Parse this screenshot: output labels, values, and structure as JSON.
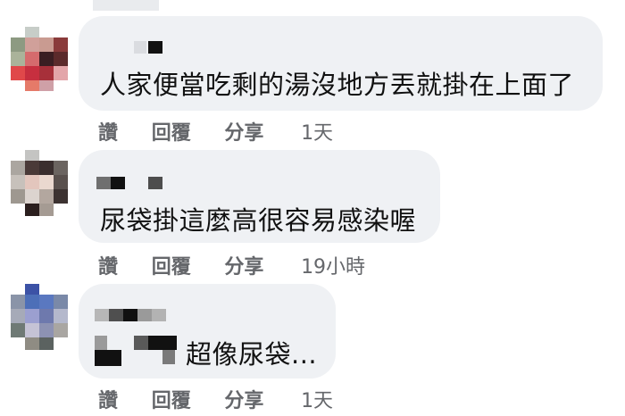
{
  "comments": [
    {
      "text": "人家便當吃剩的湯沒地方丟就掛在上面了",
      "actions": {
        "like": "讚",
        "reply": "回覆",
        "share": "分享"
      },
      "time": "1天"
    },
    {
      "text": "尿袋掛這麼高很容易感染喔",
      "actions": {
        "like": "讚",
        "reply": "回覆",
        "share": "分享"
      },
      "time": "19小時"
    },
    {
      "text": "超像尿袋...",
      "actions": {
        "like": "讚",
        "reply": "回覆",
        "share": "分享"
      },
      "time": "1天"
    }
  ],
  "colors": {
    "bubble": "#eff1f4",
    "text": "#111111",
    "meta": "#65676b"
  }
}
